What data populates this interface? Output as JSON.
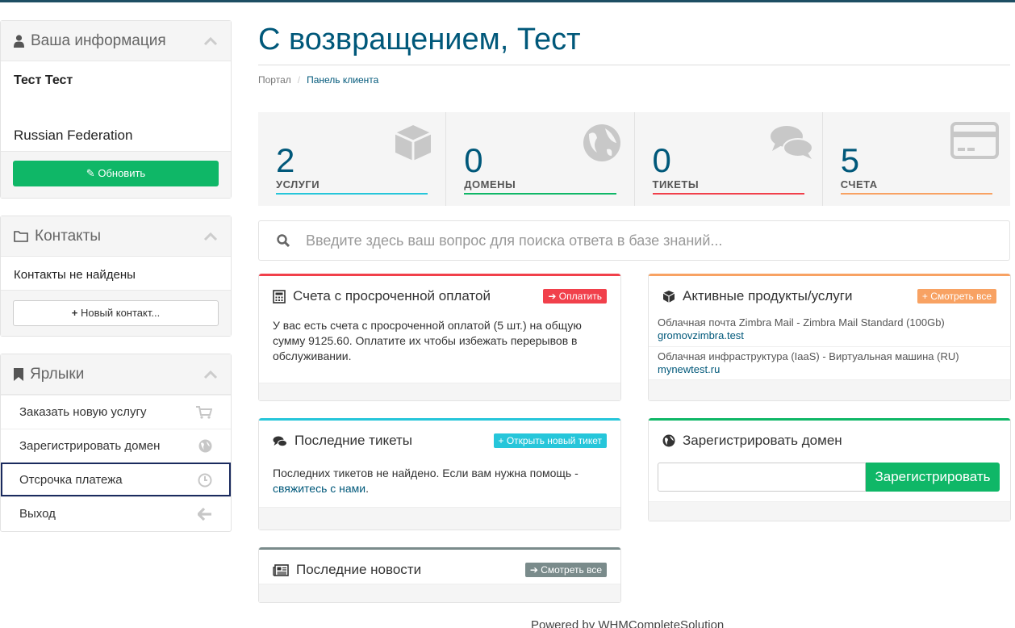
{
  "sidebar": {
    "info": {
      "title": "Ваша информация",
      "name": "Тест Тест",
      "country": "Russian Federation",
      "update_label": "Обновить"
    },
    "contacts": {
      "title": "Контакты",
      "empty": "Контакты не найдены",
      "new_label": "Новый контакт..."
    },
    "shortcuts": {
      "title": "Ярлыки",
      "items": [
        {
          "label": "Заказать новую услугу",
          "icon": "cart-icon"
        },
        {
          "label": "Зарегистрировать домен",
          "icon": "globe-icon"
        },
        {
          "label": "Отсрочка платежа",
          "icon": "clock-icon"
        },
        {
          "label": "Выход",
          "icon": "arrow-left-icon"
        }
      ]
    }
  },
  "main": {
    "title": "С возвращением, Тест",
    "breadcrumb": {
      "home": "Портал",
      "sep": "/",
      "current": "Панель клиента"
    },
    "tiles": [
      {
        "count": "2",
        "label": "УСЛУГИ",
        "color": "#26c6da",
        "icon": "cube-icon"
      },
      {
        "count": "0",
        "label": "ДОМЕНЫ",
        "color": "#0fb767",
        "icon": "globe-icon"
      },
      {
        "count": "0",
        "label": "ТИКЕТЫ",
        "color": "#f1404b",
        "icon": "comments-icon"
      },
      {
        "count": "5",
        "label": "СЧЕТА",
        "color": "#f8a263",
        "icon": "credit-card-icon"
      }
    ],
    "search_placeholder": "Введите здесь ваш вопрос для поиска ответа в базе знаний...",
    "overdue": {
      "title": "Счета с просроченной оплатой",
      "button": "Оплатить",
      "text": "У вас есть счета с просроченной оплатой (5 шт.) на общую сумму 9125.60. Оплатите их чтобы избежать перерывов в обслуживании."
    },
    "products": {
      "title": "Активные продукты/услуги",
      "button": "Смотреть все",
      "items": [
        {
          "name": "Облачная почта Zimbra Mail - Zimbra Mail Standard (100Gb)",
          "domain": "gromovzimbra.test"
        },
        {
          "name": "Облачная инфраструктура (IaaS) - Виртуальная машина (RU)",
          "domain": "mynewtest.ru"
        }
      ]
    },
    "tickets": {
      "title": "Последние тикеты",
      "button": "Открыть новый тикет",
      "text": "Последних тикетов не найдено. Если вам нужна помощь -",
      "link": "свяжитесь с нами",
      "after": "."
    },
    "domain": {
      "title": "Зарегистрировать домен",
      "button": "Зарегистрировать",
      "value": ""
    },
    "news": {
      "title": "Последние новости",
      "button": "Смотреть все"
    }
  },
  "footer": {
    "powered": "Powered by WHMCompleteSolution"
  },
  "colors": {
    "primary": "#00587a",
    "green": "#0fb767",
    "red": "#f1404b",
    "cyan": "#26c6da",
    "orange": "#f8a263",
    "gray": "#7a8b8b"
  }
}
